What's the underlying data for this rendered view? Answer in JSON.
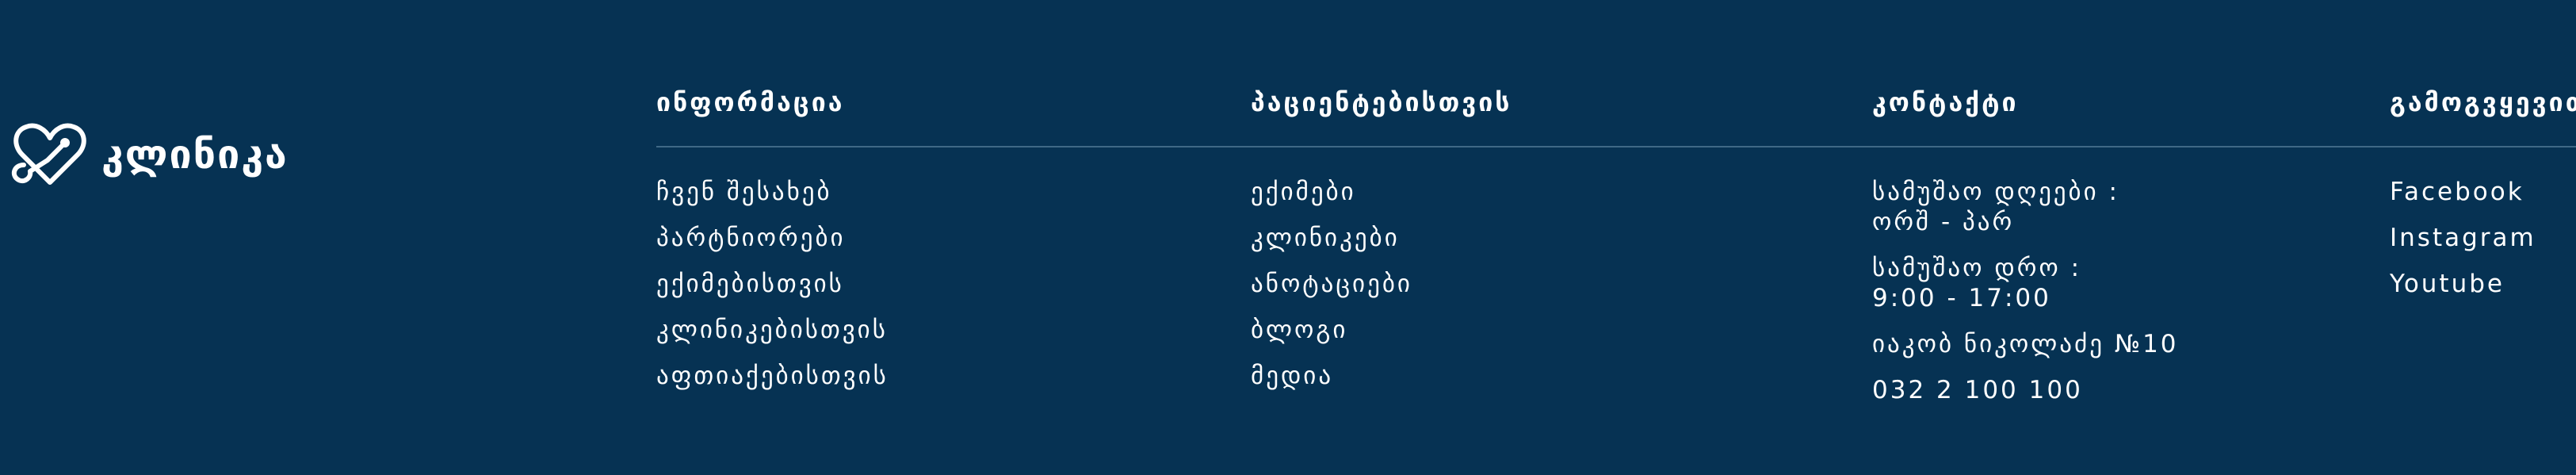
{
  "brand": {
    "name": "კლინიკა",
    "icon": "heart-stethoscope-icon"
  },
  "columns": {
    "info": {
      "title": "ინფორმაცია",
      "items": [
        "ჩვენ შესახებ",
        "პარტნიორები",
        "ექიმებისთვის",
        "კლინიკებისთვის",
        "აფთიაქებისთვის"
      ]
    },
    "patients": {
      "title": "პაციენტებისთვის",
      "items": [
        "ექიმები",
        "კლინიკები",
        "ანოტაციები",
        "ბლოგი",
        "მედია"
      ]
    },
    "contact": {
      "title": "კონტაქტი",
      "workdays_label": "სამუშაო დღეები :",
      "workdays_value": "ორშ - პარ",
      "hours_label": "სამუშაო დრო :",
      "hours_value": "9:00 - 17:00",
      "address": "იაკობ ნიკოლაძე №10",
      "phone": "032 2 100 100"
    },
    "social": {
      "title": "გამოგვყევით",
      "items": [
        "Facebook",
        "Instagram",
        "Youtube"
      ]
    }
  },
  "colors": {
    "background": "#063253",
    "text": "#ffffff",
    "divider": "#3f6886"
  }
}
